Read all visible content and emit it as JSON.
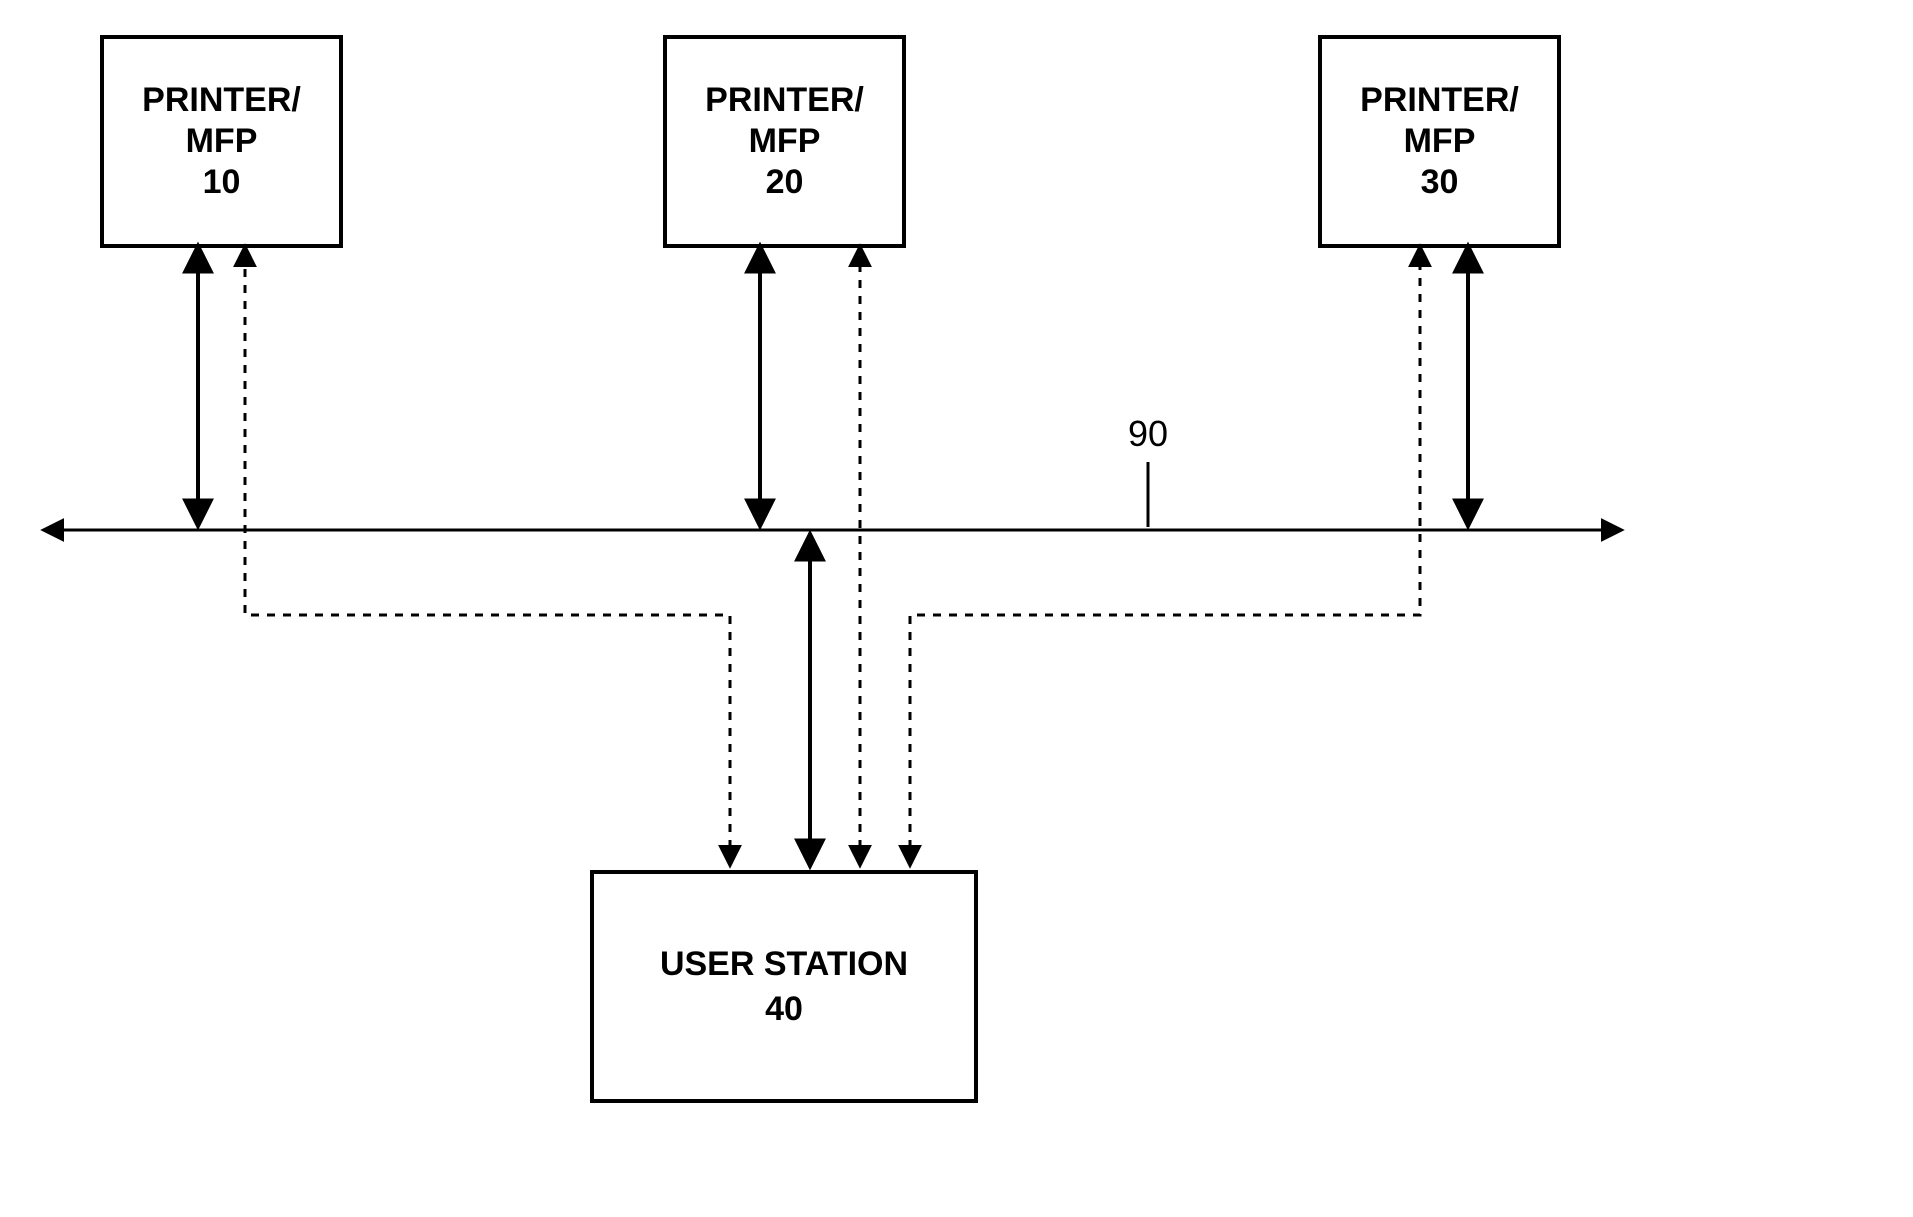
{
  "nodes": {
    "printer1": {
      "label_line1": "PRINTER/",
      "label_line2": "MFP",
      "id": "10"
    },
    "printer2": {
      "label_line1": "PRINTER/",
      "label_line2": "MFP",
      "id": "20"
    },
    "printer3": {
      "label_line1": "PRINTER/",
      "label_line2": "MFP",
      "id": "30"
    },
    "user": {
      "label": "USER STATION",
      "id": "40"
    }
  },
  "bus": {
    "id": "90"
  },
  "chart_data": {
    "type": "diagram",
    "description": "Block diagram: three PRINTER/MFP boxes (10, 20, 30) connect via solid double-arrow lines to a horizontal bus labeled 90; a USER STATION box (40) below the bus connects with one solid double-arrow to the bus and three dashed double-arrows going to each of the three printer boxes.",
    "nodes": [
      {
        "id": "10",
        "label": "PRINTER/ MFP",
        "row": "top",
        "col": "left"
      },
      {
        "id": "20",
        "label": "PRINTER/ MFP",
        "row": "top",
        "col": "center"
      },
      {
        "id": "30",
        "label": "PRINTER/ MFP",
        "row": "top",
        "col": "right"
      },
      {
        "id": "40",
        "label": "USER STATION",
        "row": "bottom",
        "col": "center"
      },
      {
        "id": "90",
        "label": "bus",
        "row": "middle",
        "col": "span"
      }
    ],
    "edges": [
      {
        "from": "10",
        "to": "90",
        "style": "solid",
        "bidirectional": true
      },
      {
        "from": "20",
        "to": "90",
        "style": "solid",
        "bidirectional": true
      },
      {
        "from": "30",
        "to": "90",
        "style": "solid",
        "bidirectional": true
      },
      {
        "from": "40",
        "to": "90",
        "style": "solid",
        "bidirectional": true
      },
      {
        "from": "40",
        "to": "10",
        "style": "dashed",
        "bidirectional": true
      },
      {
        "from": "40",
        "to": "20",
        "style": "dashed",
        "bidirectional": true
      },
      {
        "from": "40",
        "to": "30",
        "style": "dashed",
        "bidirectional": true
      }
    ]
  }
}
